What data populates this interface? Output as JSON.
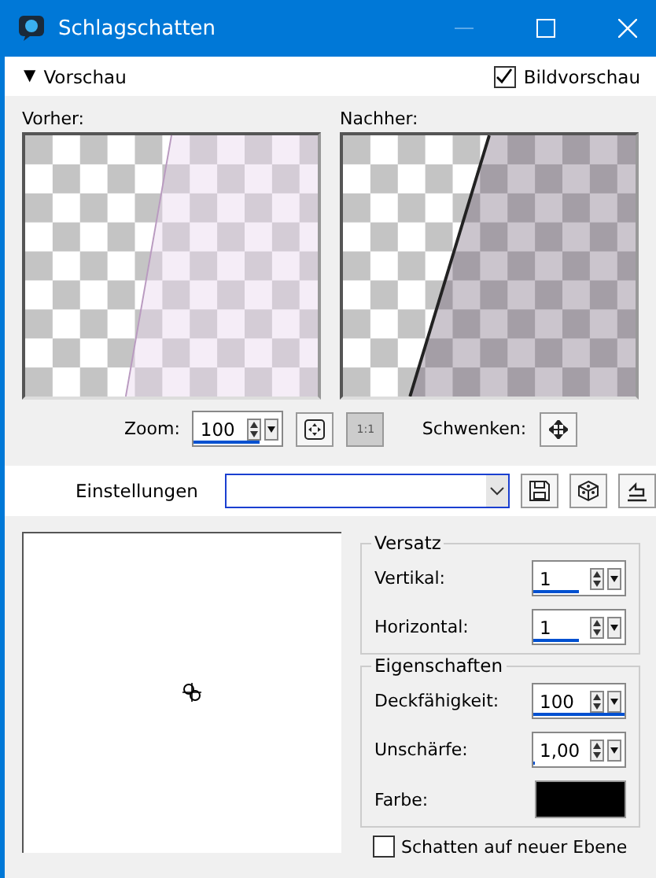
{
  "window": {
    "title": "Schlagschatten"
  },
  "preview_header": {
    "toggle": "▼",
    "label": "Vorschau",
    "expanded": true,
    "image_preview": {
      "label": "Bildvorschau",
      "checked": true
    }
  },
  "before": {
    "label": "Vorher:"
  },
  "after": {
    "label": "Nachher:"
  },
  "zoom": {
    "label": "Zoom:",
    "value": "100",
    "level": 0.75,
    "one_to_one": {
      "label": "1:1",
      "disabled": true
    }
  },
  "pan": {
    "label": "Schwenken:"
  },
  "settings": {
    "label": "Einstellungen"
  },
  "offset": {
    "title": "Versatz",
    "fields": [
      {
        "label": "Vertikal:",
        "value": "1",
        "level": 0.5
      },
      {
        "label": "Horizontal:",
        "value": "1",
        "level": 0.5
      }
    ]
  },
  "properties": {
    "title": "Eigenschaften",
    "fields": [
      {
        "label": "Deckfähigkeit:",
        "value": "100",
        "level": 1
      },
      {
        "label": "Unschärfe:",
        "value": "1,00",
        "level": 0.01
      }
    ],
    "color": {
      "label": "Farbe:",
      "color": "#000000"
    }
  },
  "new_layer": {
    "label": "Schatten auf neuer Ebene",
    "checked": false
  }
}
